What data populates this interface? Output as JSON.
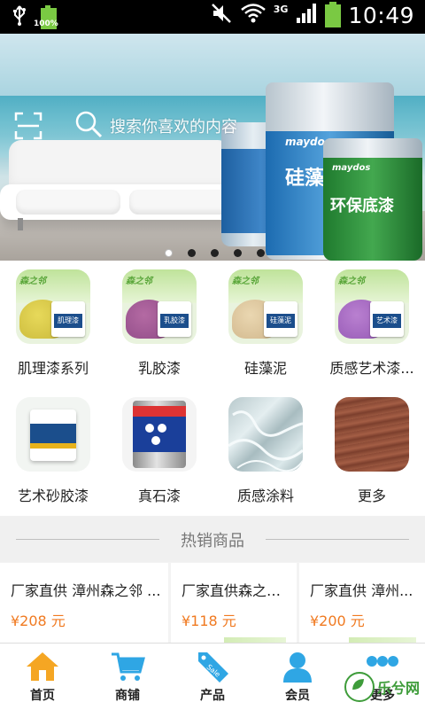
{
  "status_bar": {
    "battery_percent": "100%",
    "network": "3G",
    "time": "10:49"
  },
  "banner": {
    "search_placeholder": "搜索你喜欢的内容",
    "slides_count": 5,
    "active_slide": 1,
    "brand": "maydos 美涂士漆",
    "can_texts": [
      "硅藻泥",
      "环保底漆"
    ]
  },
  "categories": [
    {
      "label": "肌理漆系列",
      "icon": "texture-paint-icon"
    },
    {
      "label": "乳胶漆",
      "icon": "latex-paint-icon"
    },
    {
      "label": "硅藻泥",
      "icon": "diatom-mud-icon"
    },
    {
      "label": "质感艺术漆...",
      "icon": "art-paint-icon"
    },
    {
      "label": "艺术砂胶漆",
      "icon": "sand-paint-icon"
    },
    {
      "label": "真石漆",
      "icon": "stone-paint-icon"
    },
    {
      "label": "质感涂料",
      "icon": "texture-coating-icon"
    },
    {
      "label": "更多",
      "icon": "more-icon"
    }
  ],
  "hot_section": {
    "title": "热销商品"
  },
  "products": [
    {
      "name": "厂家直供 漳州森之邻 ...",
      "price": "¥208 元"
    },
    {
      "name": "厂家直供森之邻...",
      "price": "¥118 元"
    },
    {
      "name": "厂家直供 漳州...",
      "price": "¥200 元"
    }
  ],
  "bottom_nav": [
    {
      "label": "首页",
      "icon": "home-icon"
    },
    {
      "label": "商铺",
      "icon": "cart-icon"
    },
    {
      "label": "产品",
      "icon": "sale-tag-icon"
    },
    {
      "label": "会员",
      "icon": "member-icon"
    },
    {
      "label": "更多",
      "icon": "more-dots-icon"
    }
  ],
  "watermark": {
    "text": "乐兮网"
  },
  "colors": {
    "price": "#f07a21",
    "nav_icon": "#2fa6e4",
    "home_icon": "#f5a623",
    "page_bg": "#f3f3f3"
  }
}
